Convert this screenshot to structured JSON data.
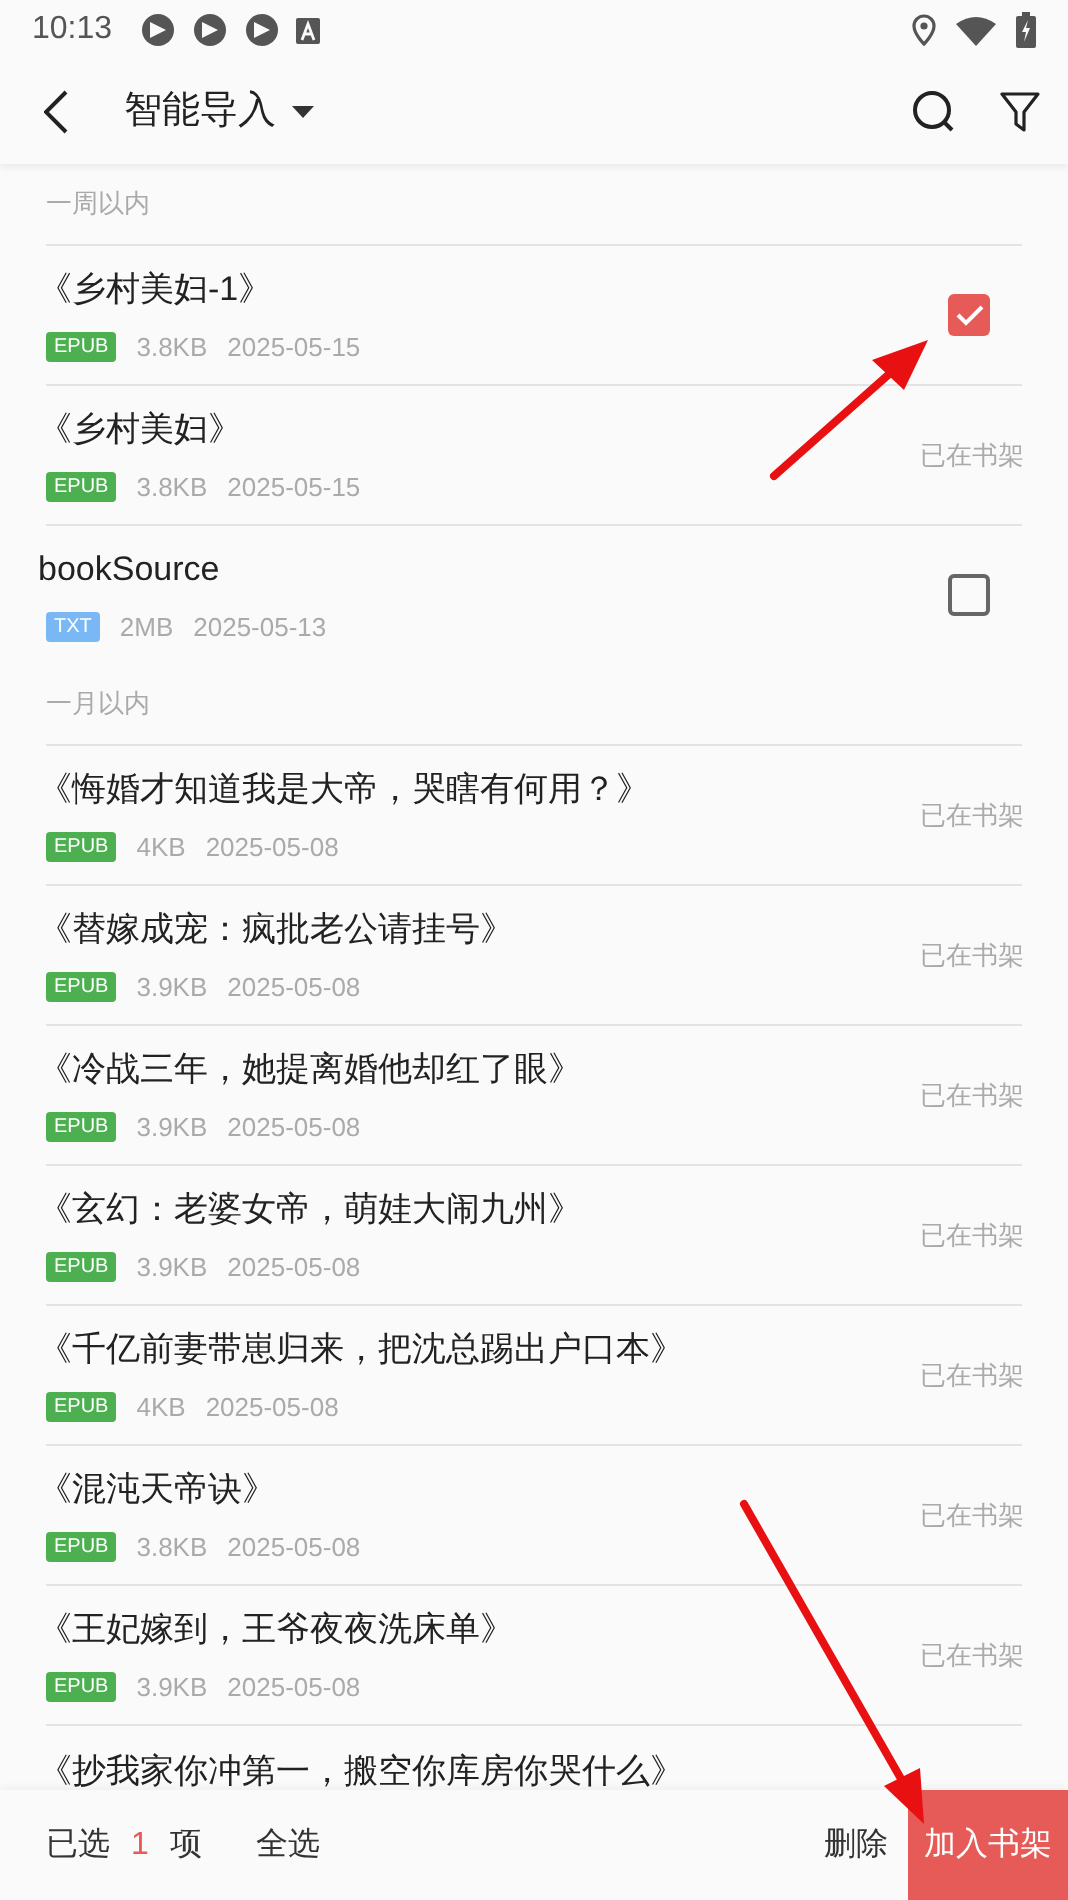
{
  "status_bar": {
    "time": "10:13"
  },
  "toolbar": {
    "title": "智能导入"
  },
  "sections": [
    {
      "header": "一周以内",
      "items": [
        {
          "title": "《乡村美妇-1》",
          "format": "EPUB",
          "color": "#4caf50",
          "size": "3.8KB",
          "date": "2025-05-15",
          "kind": "checkbox",
          "checked": true
        },
        {
          "title": "《乡村美妇》",
          "format": "EPUB",
          "color": "#4caf50",
          "size": "3.8KB",
          "date": "2025-05-15",
          "kind": "shelved",
          "status": "已在书架"
        },
        {
          "title": "bookSource",
          "format": "TXT",
          "color": "#7ab8f5",
          "size": "2MB",
          "date": "2025-05-13",
          "kind": "checkbox",
          "checked": false
        }
      ]
    },
    {
      "header": "一月以内",
      "items": [
        {
          "title": "《悔婚才知道我是大帝，哭瞎有何用？》",
          "format": "EPUB",
          "color": "#4caf50",
          "size": "4KB",
          "date": "2025-05-08",
          "kind": "shelved",
          "status": "已在书架"
        },
        {
          "title": "《替嫁成宠：疯批老公请挂号》",
          "format": "EPUB",
          "color": "#4caf50",
          "size": "3.9KB",
          "date": "2025-05-08",
          "kind": "shelved",
          "status": "已在书架"
        },
        {
          "title": "《冷战三年，她提离婚他却红了眼》",
          "format": "EPUB",
          "color": "#4caf50",
          "size": "3.9KB",
          "date": "2025-05-08",
          "kind": "shelved",
          "status": "已在书架"
        },
        {
          "title": "《玄幻：老婆女帝，萌娃大闹九州》",
          "format": "EPUB",
          "color": "#4caf50",
          "size": "3.9KB",
          "date": "2025-05-08",
          "kind": "shelved",
          "status": "已在书架"
        },
        {
          "title": "《千亿前妻带崽归来，把沈总踢出户口本》",
          "format": "EPUB",
          "color": "#4caf50",
          "size": "4KB",
          "date": "2025-05-08",
          "kind": "shelved",
          "status": "已在书架"
        },
        {
          "title": "《混沌天帝诀》",
          "format": "EPUB",
          "color": "#4caf50",
          "size": "3.8KB",
          "date": "2025-05-08",
          "kind": "shelved",
          "status": "已在书架"
        },
        {
          "title": "《王妃嫁到，王爷夜夜洗床单》",
          "format": "EPUB",
          "color": "#4caf50",
          "size": "3.9KB",
          "date": "2025-05-08",
          "kind": "shelved",
          "status": "已在书架"
        },
        {
          "title": "《抄我家你冲第一，搬空你库房你哭什么》",
          "kind": "partial"
        }
      ]
    }
  ],
  "bottom_bar": {
    "selected_prefix": "已选",
    "selected_count": "1",
    "selected_suffix": "项",
    "select_all": "全选",
    "delete": "删除",
    "add": "加入书架"
  }
}
